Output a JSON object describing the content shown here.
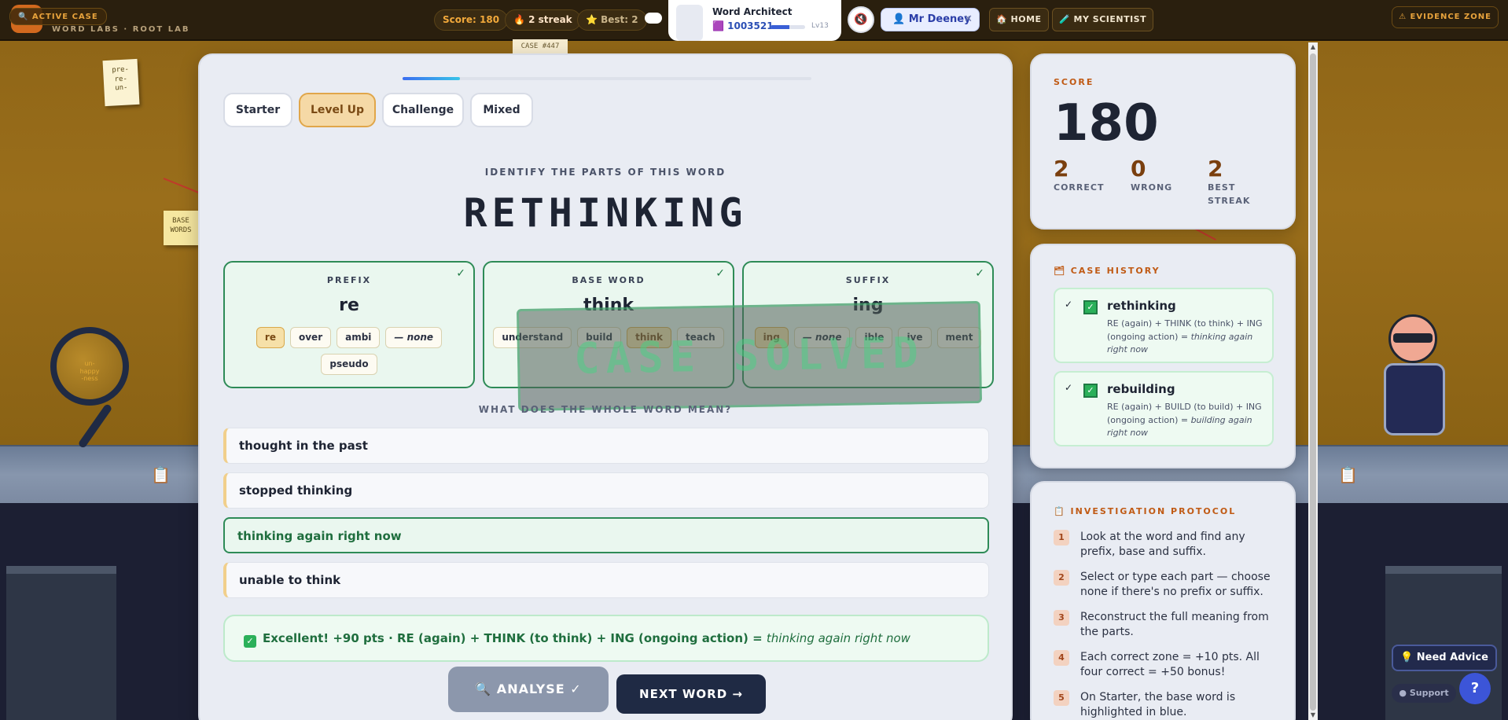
{
  "app": {
    "active_case_label": "🔍 ACTIVE CASE",
    "subtitle": "WORD LABS · ROOT LAB",
    "case_tag": "CASE #447"
  },
  "topbar": {
    "score": "Score: 180",
    "streak": "🔥 2 streak",
    "best": "⭐ Best: 2",
    "profile": {
      "name": "Word Architect",
      "id": "1003521",
      "level": "Lv13",
      "level_progress": 0.55
    },
    "teacher": "Mr Deeney",
    "home": "🏠 HOME",
    "my_scientist": "🧪 MY SCIENTIST",
    "evidence_zone": "⚠ EVIDENCE ZONE"
  },
  "background": {
    "sticky_note_1": "pre-\nre-\nun-",
    "sticky_note_2": "BASE\nWORDS",
    "magnifier_text": "un-\nhappy\n-ness"
  },
  "tabs": [
    {
      "label": "Starter",
      "active": false
    },
    {
      "label": "Level Up",
      "active": true
    },
    {
      "label": "Challenge",
      "active": false
    },
    {
      "label": "Mixed",
      "active": false
    }
  ],
  "progress": 0.14,
  "puzzle": {
    "instruction": "IDENTIFY THE PARTS OF THIS WORD",
    "word": "RETHINKING",
    "zones": [
      {
        "label": "PREFIX",
        "value": "re",
        "options": [
          "re",
          "over",
          "ambi",
          "— none",
          "pseudo"
        ],
        "selected": "re"
      },
      {
        "label": "BASE WORD",
        "value": "think",
        "options": [
          "understand",
          "build",
          "think",
          "teach"
        ],
        "selected": "think"
      },
      {
        "label": "SUFFIX",
        "value": "ing",
        "options": [
          "ing",
          "— none",
          "ible",
          "ive",
          "ment"
        ],
        "selected": "ing"
      }
    ],
    "stamp": "CASE SOLVED",
    "question": "WHAT DOES THE WHOLE WORD MEAN?",
    "answers": [
      {
        "text": "thought in the past",
        "correct": false
      },
      {
        "text": "stopped thinking",
        "correct": false
      },
      {
        "text": "thinking again right now",
        "correct": true
      },
      {
        "text": "unable to think",
        "correct": false
      }
    ],
    "feedback": {
      "check": "✓",
      "text": "Excellent! +90 pts  ·  RE (again) + THINK (to think) + ING (ongoing action) = ",
      "meaning": "thinking again right now"
    },
    "analyse_label": "🔍 ANALYSE ✓",
    "next_label": "NEXT WORD →"
  },
  "score_panel": {
    "label": "SCORE",
    "value": "180",
    "correct": "2",
    "correct_label": "CORRECT",
    "wrong": "0",
    "wrong_label": "WRONG",
    "best_streak": "2",
    "best_streak_label": "BEST\nSTREAK"
  },
  "history": {
    "title": "🗂 CASE HISTORY",
    "items": [
      {
        "word": "rethinking",
        "formula": "RE (again) + THINK (to think) + ING (ongoing action) = ",
        "meaning": "thinking again right now"
      },
      {
        "word": "rebuilding",
        "formula": "RE (again) + BUILD (to build) + ING (ongoing action) = ",
        "meaning": "building again right now"
      }
    ]
  },
  "protocol": {
    "title": "📋 INVESTIGATION PROTOCOL",
    "steps": [
      "Look at the word and find any prefix, base and suffix.",
      "Select or type each part — choose none if there's no prefix or suffix.",
      "Reconstruct the full meaning from the parts.",
      "Each correct zone = +10 pts. All four correct = +50 bonus!",
      "On Starter, the base word is highlighted in blue."
    ]
  },
  "help": {
    "advice": "💡 Need Advice",
    "support": "● Support",
    "question": "?"
  },
  "colors": {
    "accent_orange": "#c05a14",
    "success_green": "#2e8b57",
    "navy": "#1f2a44",
    "wall": "#8d6416"
  }
}
